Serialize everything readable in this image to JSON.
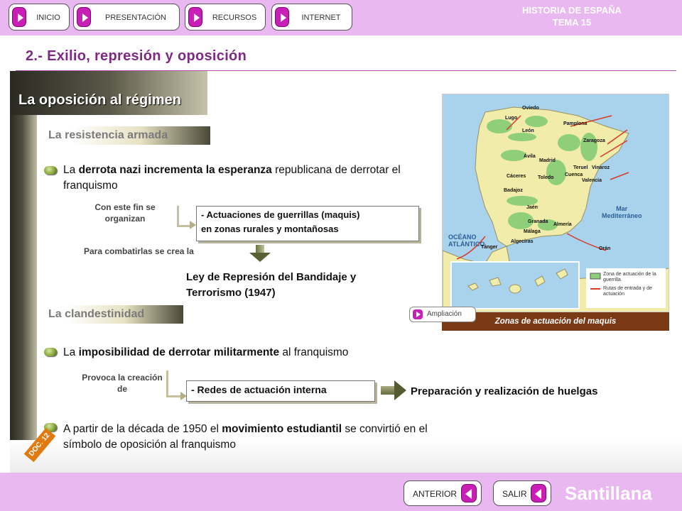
{
  "nav": {
    "inicio": "INICIO",
    "presentacion": "PRESENTACIÓN",
    "recursos": "RECURSOS",
    "internet": "INTERNET"
  },
  "header": {
    "line1": "HISTORIA DE ESPAÑA",
    "line2": "TEMA 15"
  },
  "page_title": "2.- Exilio, represión y oposición",
  "section_title": "La oposición al régimen",
  "armada": {
    "heading": "La resistencia armada",
    "bullet_pre": "La ",
    "bullet_bold": "derrota nazi incrementa la esperanza",
    "bullet_post": " republicana de derrotar el franquismo",
    "connector": "Con este fin se organizan",
    "box_line1": "- Actuaciones de guerrillas (maquis)",
    "box_line2": "en zonas rurales y montañosas",
    "combat": "Para combatirlas se crea la",
    "law_line1": "Ley de Represión del Bandidaje y",
    "law_line2": "Terrorismo (1947)"
  },
  "clandestinidad": {
    "heading": "La clandestinidad",
    "bullet1_pre": "La ",
    "bullet1_bold": "imposibilidad de derrotar militarmente",
    "bullet1_post": " al franquismo",
    "connector": "Provoca la creación de",
    "box": "- Redes de actuación interna",
    "result": "Preparación y realización de huelgas",
    "bullet2_pre": "A partir de la década de 1950 el ",
    "bullet2_bold": "movimiento estudiantil",
    "bullet2_post": " se convirtió en el símbolo de oposición al franquismo"
  },
  "map": {
    "caption": "Zonas de actuación del maquis",
    "ampliacion": "Ampliación",
    "sea_atlantic_1": "OCÉANO",
    "sea_atlantic_2": "ATLÁNTICO",
    "sea_med_1": "Mar",
    "sea_med_2": "Mediterráneo",
    "legend_zone": "Zona de actuación de la guerrilla",
    "legend_routes": "Rutas de entrada y de actuación",
    "cities": [
      "Oviedo",
      "Lugo",
      "León",
      "Pamplona",
      "Zaragoza",
      "Ávila",
      "Madrid",
      "Teruel",
      "Vinaroz",
      "Cáceres",
      "Toledo",
      "Cuenca",
      "Valencia",
      "Badajoz",
      "Jaén",
      "Granada",
      "Almería",
      "Málaga",
      "Algeciras",
      "Tánger",
      "Orán"
    ],
    "colors": {
      "sea": "#a9d3ec",
      "land": "#f2ecaa",
      "guerrilla": "#8fcf7a",
      "routes": "#d83a2a"
    }
  },
  "doc_badge": "DOC. 12",
  "footer": {
    "anterior": "ANTERIOR",
    "salir": "SALIR",
    "brand": "Santillana"
  }
}
